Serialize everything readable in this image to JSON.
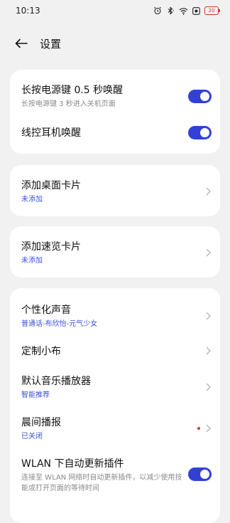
{
  "status_bar": {
    "time": "10:13",
    "icons": [
      "alarm-icon",
      "bluetooth-icon",
      "wifi-icon",
      "screen-record-icon",
      "battery-icon"
    ],
    "battery": "20",
    "battery_color": "#d8342b"
  },
  "header": {
    "title": "设置",
    "back_icon": "arrow-left-icon"
  },
  "colors": {
    "accent": "#3340d6",
    "link": "#3b52d8",
    "background": "#f1f1f1"
  },
  "cards": {
    "wake": {
      "power_key": {
        "title": "长按电源键 0.5 秒唤醒",
        "subtitle": "长按电源键 3 秒进入关机页面",
        "enabled": true
      },
      "headset": {
        "title": "线控耳机唤醒",
        "enabled": true
      }
    },
    "desktop_card": {
      "title": "添加桌面卡片",
      "subtitle": "未添加"
    },
    "overview_card": {
      "title": "添加速览卡片",
      "subtitle": "未添加"
    },
    "more": {
      "voice": {
        "title": "个性化声音",
        "subtitle": "普通话-布欣怡-元气少女"
      },
      "custom": {
        "title": "定制小布"
      },
      "music": {
        "title": "默认音乐播放器",
        "subtitle": "智能推荐"
      },
      "morning": {
        "title": "晨间播报",
        "subtitle": "已关闭",
        "has_dot": true
      },
      "wlan": {
        "title": "WLAN 下自动更新插件",
        "subtitle": "连接至 WLAN 网络时自动更新插件，以减少使用技能或打开页面的等待时间",
        "enabled": true
      }
    }
  }
}
